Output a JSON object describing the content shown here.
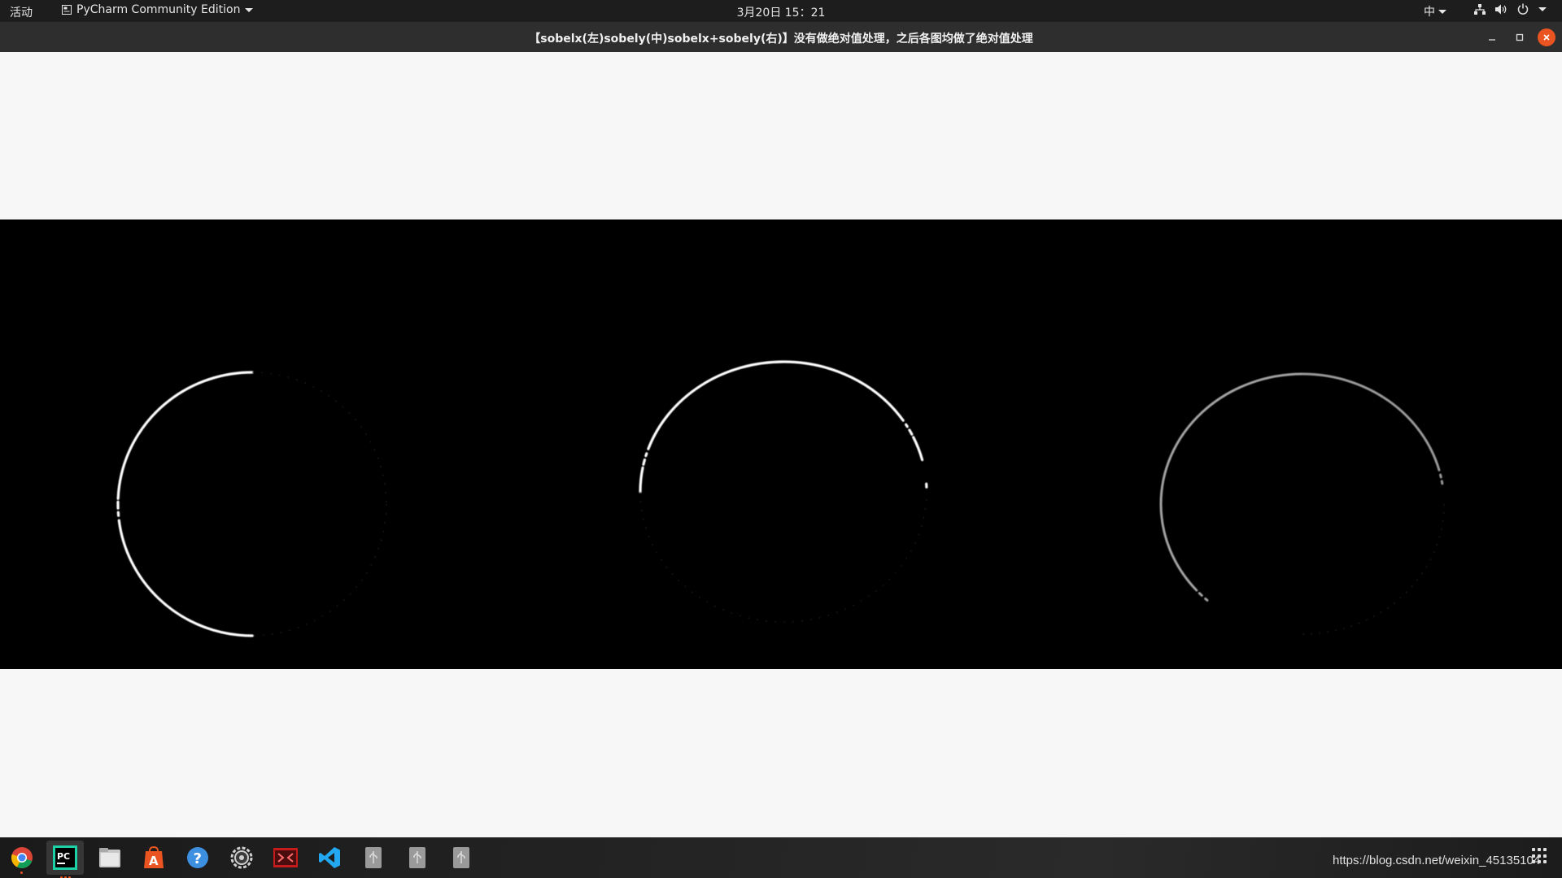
{
  "topbar": {
    "activities": "活动",
    "app_name": "PyCharm Community Edition",
    "clock": "3月20日 15：21",
    "input_method": "中"
  },
  "window": {
    "title": "【sobelx(左)sobely(中)sobelx+sobely(右)】没有做绝对值处理，之后各图均做了绝对值处理"
  },
  "dock": {
    "apps": [
      "chrome-icon",
      "pycharm-icon",
      "files-icon",
      "software-center-icon",
      "help-icon",
      "settings-icon",
      "screenshot-app-icon",
      "vscode-icon",
      "usb-drive-icon",
      "usb-drive-icon",
      "usb-drive-icon"
    ],
    "watermark": "https://blog.csdn.net/weixin_45135104"
  },
  "colors": {
    "topbar_bg": "#1d1d1d",
    "titlebar_bg": "#2e2e2e",
    "close_button": "#e95420",
    "canvas_bg": "#f7f7f7",
    "image_bg": "#000000"
  }
}
